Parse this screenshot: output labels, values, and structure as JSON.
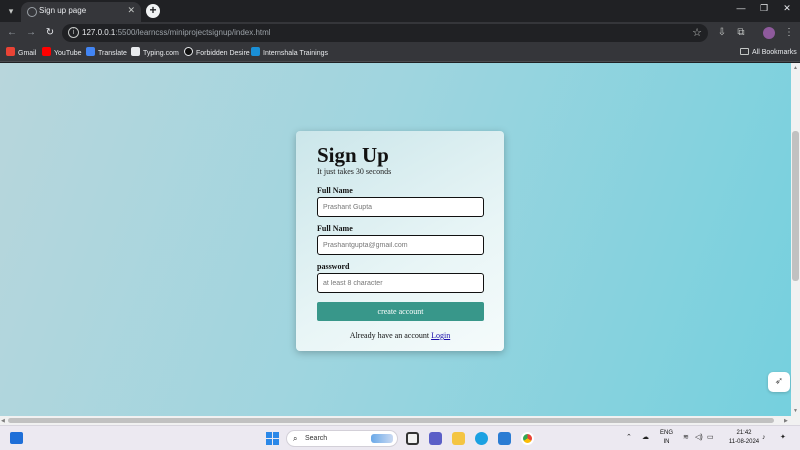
{
  "browser": {
    "tab_title": "Sign up page",
    "new_tab_symbol": "+",
    "url_host": "127.0.0.1",
    "url_path": ":5500/learncss/miniprojectsignup/index.html",
    "bookmarks": [
      "Gmail",
      "YouTube",
      "Translate",
      "Typing.com",
      "Forbidden Desire",
      "Internshala Trainings"
    ],
    "all_bookmarks": "All Bookmarks",
    "colors": {
      "chrome": "#202124",
      "toolbar": "#35363a"
    }
  },
  "page": {
    "title": "Sign Up",
    "subtitle": "It just takes 30 seconds",
    "fields": [
      {
        "label": "Full Name",
        "placeholder": "Prashant Gupta"
      },
      {
        "label": "Full Name",
        "placeholder": "Prashantgupta@gmail.com"
      },
      {
        "label": "password",
        "placeholder": "at least 8 character"
      }
    ],
    "submit_label": "create account",
    "login_prompt": "Already have an account ",
    "login_link": "Login",
    "colors": {
      "button": "#38978a",
      "link": "#1a0dab",
      "bg_start": "#b8d6dc",
      "bg_end": "#75d0de"
    }
  },
  "taskbar": {
    "search_label": "Search",
    "language": "ENG",
    "region": "IN",
    "time": "21:42",
    "date": "11-08-2024"
  }
}
